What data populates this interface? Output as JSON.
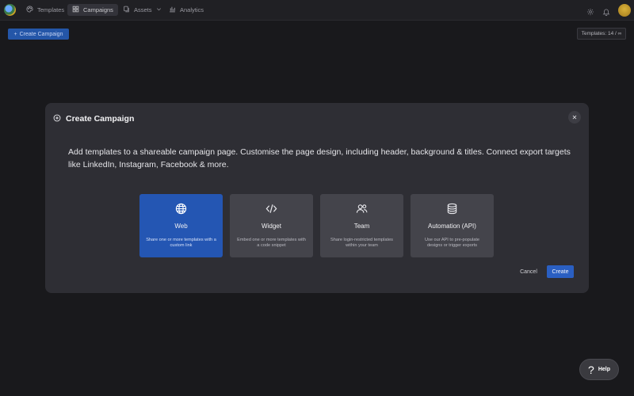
{
  "nav": {
    "items": [
      {
        "label": "Templates",
        "icon": "palette-icon"
      },
      {
        "label": "Campaigns",
        "icon": "grid-icon"
      },
      {
        "label": "Assets",
        "icon": "assets-icon"
      },
      {
        "label": "Analytics",
        "icon": "chart-icon"
      }
    ],
    "active": "Campaigns"
  },
  "toolbar": {
    "create_campaign_label": "Create Campaign",
    "templates_count": "Templates: 14 / ∞"
  },
  "modal": {
    "title": "Create Campaign",
    "description": "Add templates to a shareable campaign page. Customise the page design, including header, background & titles. Connect export targets like LinkedIn, Instagram, Facebook & more.",
    "options": [
      {
        "title": "Web",
        "subtitle": "Share one or more templates with a custom link",
        "icon": "globe-icon",
        "selected": true
      },
      {
        "title": "Widget",
        "subtitle": "Embed one or more templates with a code snippet",
        "icon": "code-icon",
        "selected": false
      },
      {
        "title": "Team",
        "subtitle": "Share login-restricted templates within your team",
        "icon": "users-icon",
        "selected": false
      },
      {
        "title": "Automation (API)",
        "subtitle": "Use our API to pre-populate designs or trigger exports",
        "icon": "database-icon",
        "selected": false
      }
    ],
    "cancel_label": "Cancel",
    "create_label": "Create"
  },
  "help": {
    "label": "Help"
  },
  "colors": {
    "accent": "#2456b3",
    "background": "#19191c",
    "modal": "#2e2e34",
    "card": "#44444b"
  }
}
